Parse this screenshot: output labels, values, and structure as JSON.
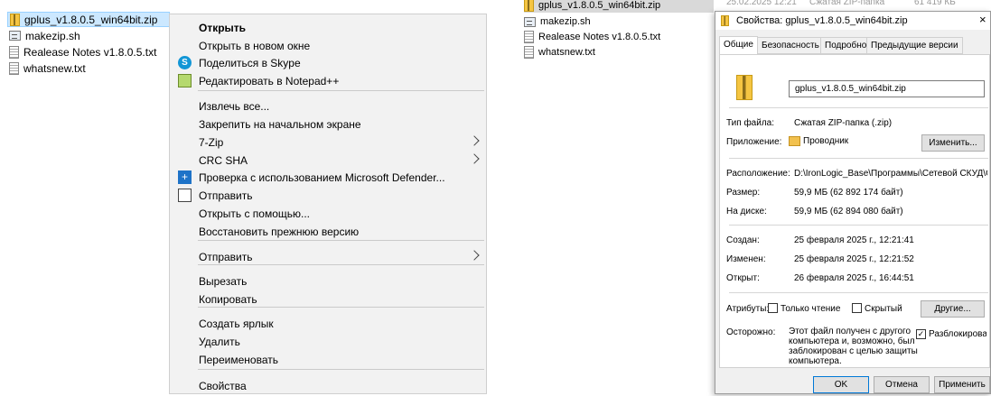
{
  "left_files": [
    {
      "name": "gplus_v1.8.0.5_win64bit.zip",
      "icon": "zip-folder-icon",
      "selected": true
    },
    {
      "name": "makezip.sh",
      "icon": "shell-script-icon"
    },
    {
      "name": "Realease Notes v1.8.0.5.txt",
      "icon": "text-file-icon"
    },
    {
      "name": "whatsnew.txt",
      "icon": "text-file-icon"
    }
  ],
  "context_menu": {
    "items": [
      {
        "label": "Открыть",
        "bold": true
      },
      {
        "label": "Открыть в новом окне"
      },
      {
        "label": "Поделиться в Skype",
        "icon": "skype-icon"
      },
      {
        "label": "Редактировать в Notepad++",
        "icon": "notepadpp-icon"
      },
      {
        "label": "Извлечь все..."
      },
      {
        "label": "Закрепить на начальном экране"
      },
      {
        "label": "7-Zip",
        "submenu": true
      },
      {
        "label": "CRC SHA",
        "submenu": true
      },
      {
        "label": "Проверка с использованием Microsoft Defender...",
        "icon": "defender-icon"
      },
      {
        "label": "Отправить",
        "icon": "share-icon"
      },
      {
        "label": "Открыть с помощью..."
      },
      {
        "label": "Восстановить прежнюю версию"
      },
      {
        "label": "Отправить",
        "submenu": true
      },
      {
        "label": "Вырезать"
      },
      {
        "label": "Копировать"
      },
      {
        "label": "Создать ярлык"
      },
      {
        "label": "Удалить"
      },
      {
        "label": "Переименовать"
      },
      {
        "label": "Свойства"
      }
    ]
  },
  "right_files": [
    {
      "name": "gplus_v1.8.0.5_win64bit.zip",
      "date": "25.02.2025 12:21",
      "type": "Сжатая ZIP-папка",
      "size": "61 419 КБ"
    },
    {
      "name": "makezip.sh"
    },
    {
      "name": "Realease Notes v1.8.0.5.txt"
    },
    {
      "name": "whatsnew.txt"
    }
  ],
  "dialog": {
    "title": "Свойства: gplus_v1.8.0.5_win64bit.zip",
    "close": "×",
    "tabs": [
      "Общие",
      "Безопасность",
      "Подробно",
      "Предыдущие версии"
    ],
    "filename": "gplus_v1.8.0.5_win64bit.zip",
    "type_label": "Тип файла:",
    "type_value": "Сжатая ZIP-папка (.zip)",
    "app_label": "Приложение:",
    "app_value": "Проводник",
    "change_button": "Изменить...",
    "location_label": "Расположение:",
    "location_value": "D:\\IronLogic_Base\\Программы\\Сетевой СКУД\\G",
    "size_label": "Размер:",
    "size_value": "59,9 МБ (62 892 174 байт)",
    "disk_label": "На диске:",
    "disk_value": "59,9 МБ (62 894 080 байт)",
    "created_label": "Создан:",
    "created_value": "25 февраля 2025 г., 12:21:41",
    "modified_label": "Изменен:",
    "modified_value": "25 февраля 2025 г., 12:21:52",
    "opened_label": "Открыт:",
    "opened_value": "26 февраля 2025 г., 16:44:51",
    "attrs_label": "Атрибуты:",
    "readonly_label": "Только чтение",
    "hidden_label": "Скрытый",
    "other_button": "Другие...",
    "warning_label": "Осторожно:",
    "warning_text": "Этот файл получен с другого компьютера и, возможно, был заблокирован с целью защиты компьютера.",
    "unblock_label": "Разблокировать",
    "unblock_checked": true,
    "ok_button": "OK",
    "cancel_button": "Отмена",
    "apply_button": "Применить"
  }
}
